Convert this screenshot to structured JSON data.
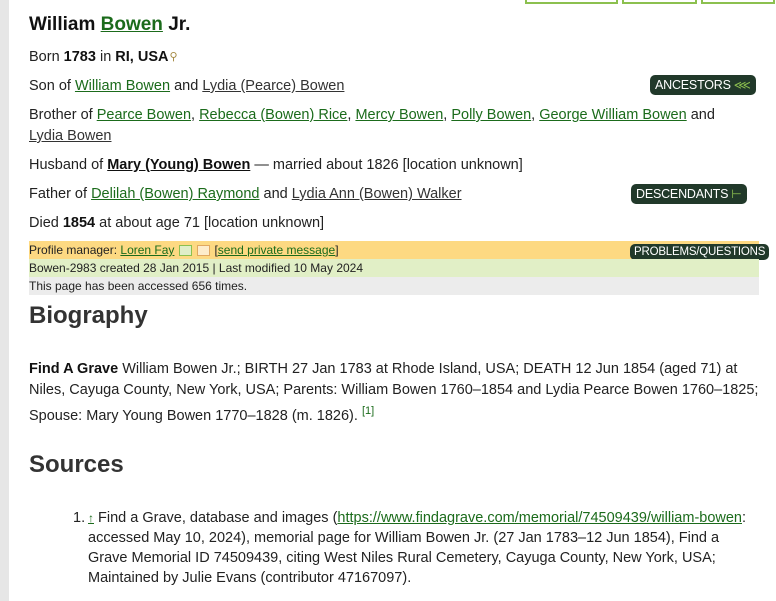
{
  "profile": {
    "first_name": "William",
    "last_name": "Bowen",
    "suffix": "Jr.",
    "born_label": "Born",
    "born_year": "1783",
    "born_in": "in",
    "born_place": "RI, USA",
    "pin_icon": "map-pin-icon",
    "son_of_label": "Son of",
    "father": "William Bowen",
    "and": "and",
    "mother": "Lydia (Pearce) Bowen",
    "brother_of_label": "Brother of",
    "siblings": [
      "Pearce Bowen",
      "Rebecca (Bowen) Rice",
      "Mercy Bowen",
      "Polly Bowen",
      "George William Bowen",
      "Lydia Bowen"
    ],
    "husband_of_label": "Husband of",
    "spouse": "Mary (Young) Bowen",
    "marriage_text": "— married about 1826 [location unknown]",
    "father_of_label": "Father of",
    "children": [
      "Delilah (Bowen) Raymond",
      "Lydia Ann (Bowen) Walker"
    ],
    "died_label": "Died",
    "died_year": "1854",
    "died_text": "at about age 71 [location unknown]"
  },
  "buttons": {
    "ancestors": "ANCESTORS",
    "descendants": "DESCENDANTS",
    "problems": "PROBLEMS/QUESTIONS"
  },
  "meta": {
    "manager_label": "Profile manager:",
    "manager_name": "Loren Fay",
    "send_message": "send private message",
    "created": "Bowen-2983 created 28 Jan 2015 | Last modified 10 May 2024",
    "accessed": "This page has been accessed 656 times."
  },
  "biography": {
    "heading": "Biography",
    "source_bold": "Find A Grave",
    "text": "William Bowen Jr.; BIRTH 27 Jan 1783 at Rhode Island, USA; DEATH 12 Jun 1854 (aged 71) at Niles, Cayuga County, New York, USA; Parents: William Bowen 1760–1854 and Lydia Pearce Bowen 1760–1825; Spouse: Mary Young Bowen 1770–1828 (m. 1826).",
    "footnote": "[1]"
  },
  "sources": {
    "heading": "Sources",
    "items": [
      {
        "number": "1.",
        "back_arrow": "↑",
        "prefix": "Find a Grave, database and images (",
        "url": "https://www.findagrave.com/memorial/74509439/william-bowen",
        "suffix": ": accessed May 10, 2024), memorial page for William Bowen Jr. (27 Jan 1783–12 Jun 1854), Find a Grave Memorial ID 74509439, citing West Niles Rural Cemetery, Cayuga County, New York, USA; Maintained by Julie Evans (contributor 47167097)."
      }
    ]
  }
}
